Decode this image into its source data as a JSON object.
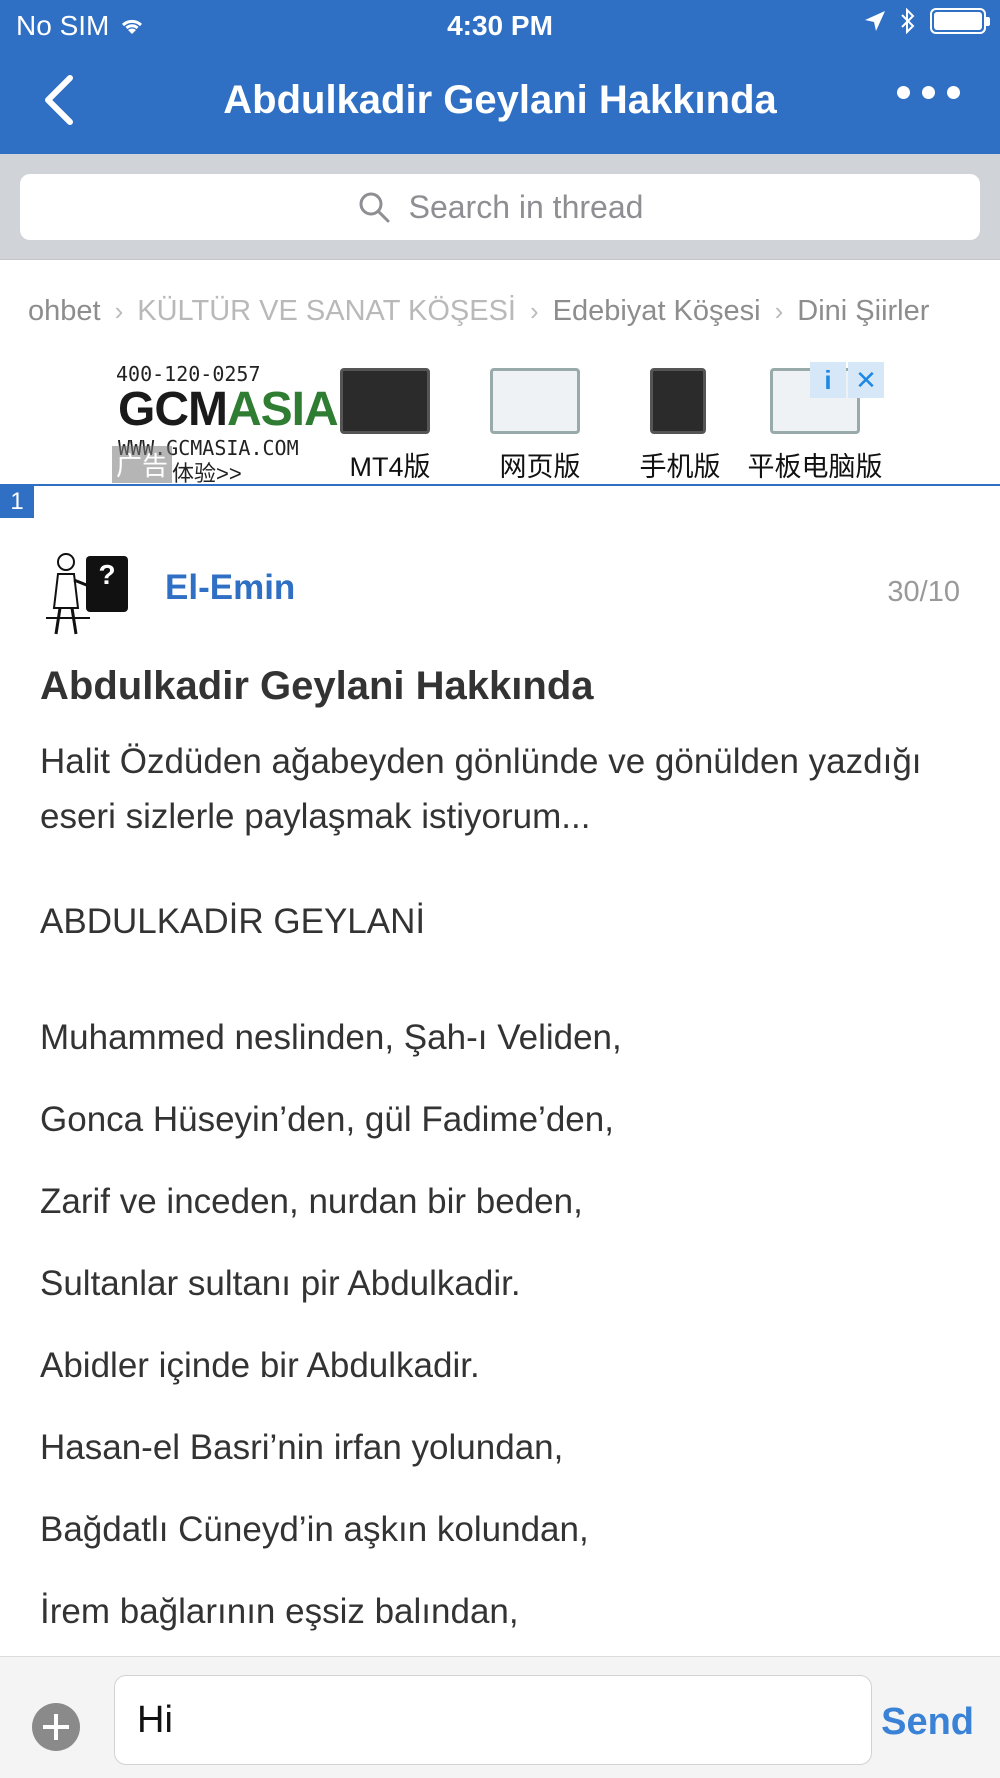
{
  "status_bar": {
    "carrier": "No SIM",
    "time": "4:30 PM"
  },
  "nav": {
    "title": "Abdulkadir Geylani Hakkında",
    "back_icon": "chevron-left-icon",
    "more_icon": "more-dots-icon"
  },
  "search": {
    "placeholder": "Search in thread"
  },
  "breadcrumbs": [
    "ohbet",
    "KÜLTÜR VE SANAT KÖŞESİ",
    "Edebiyat Köşesi",
    "Dini Şiirler"
  ],
  "ad": {
    "phone": "400-120-0257",
    "brand_part1": "GCM",
    "brand_part2": "ASIA",
    "url": "WWW.GCMASIA.COM",
    "cta": "体验>>",
    "tag": "广告",
    "products": [
      "MT4版",
      "网页版",
      "手机版",
      "平板电脑版"
    ],
    "info_symbol": "i",
    "close_symbol": "✕"
  },
  "post": {
    "number": "1",
    "author": "El-Emin",
    "date": "30/10",
    "title": "Abdulkadir Geylani Hakkında",
    "intro": "Halit Özdüden ağabeyden gönlünde ve gönülden yazdığı eseri sizlerle paylaşmak istiyorum...",
    "heading": "ABDULKADİR GEYLANİ",
    "lines": [
      "Muhammed neslinden, Şah-ı Veliden,",
      "Gonca Hüseyin’den, gül Fadime’den,",
      "Zarif ve inceden, nurdan bir beden,",
      "Sultanlar sultanı pir Abdulkadir.",
      "Abidler içinde bir Abdulkadir.",
      "Hasan-el Basri’nin irfan yolundan,",
      "Bağdatlı Cüneyd’in aşkın kolundan,",
      "İrem bağlarının eşsiz balından,"
    ]
  },
  "composer": {
    "value": "Hi",
    "send_label": "Send"
  },
  "colors": {
    "brand_blue": "#2f6fc4",
    "link_blue": "#3a82d6"
  }
}
